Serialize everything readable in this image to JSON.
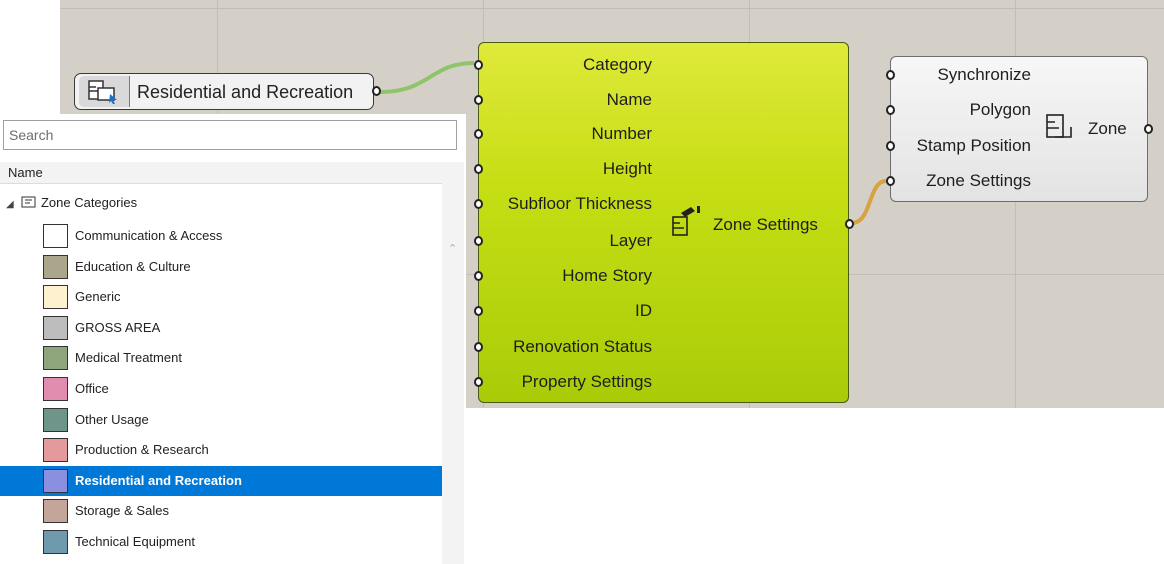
{
  "value_list": {
    "text": "Residential and Recreation",
    "icon": "value-list-icon"
  },
  "zone_settings": {
    "inputs": [
      "Category",
      "Name",
      "Number",
      "Height",
      "Subfloor Thickness",
      "Layer",
      "Home Story",
      "ID",
      "Renovation Status",
      "Property Settings"
    ],
    "output": "Zone Settings",
    "icon": "zone-settings-icon",
    "color": "#c6de14"
  },
  "zone": {
    "inputs": [
      "Synchronize",
      "Polygon",
      "Stamp Position",
      "Zone Settings"
    ],
    "output": "Zone",
    "icon": "zone-icon"
  },
  "panel": {
    "search_placeholder": "Search",
    "column_header": "Name",
    "root_label": "Zone Categories",
    "items": [
      {
        "label": "Communication & Access",
        "color": "#ffffff"
      },
      {
        "label": "Education & Culture",
        "color": "#aba68b"
      },
      {
        "label": "Generic",
        "color": "#fdf1cf"
      },
      {
        "label": "GROSS AREA",
        "color": "#bdbdbd"
      },
      {
        "label": "Medical Treatment",
        "color": "#8fa67d"
      },
      {
        "label": "Office",
        "color": "#e08db0"
      },
      {
        "label": "Other Usage",
        "color": "#6f9489"
      },
      {
        "label": "Production & Research",
        "color": "#e49a9a"
      },
      {
        "label": "Residential and Recreation",
        "color": "#8a8fe0",
        "selected": true
      },
      {
        "label": "Storage & Sales",
        "color": "#c4a59a"
      },
      {
        "label": "Technical Equipment",
        "color": "#6f9aae"
      }
    ]
  },
  "wire_colors": {
    "green": "#8fc46a",
    "orange": "#d7a23f"
  }
}
